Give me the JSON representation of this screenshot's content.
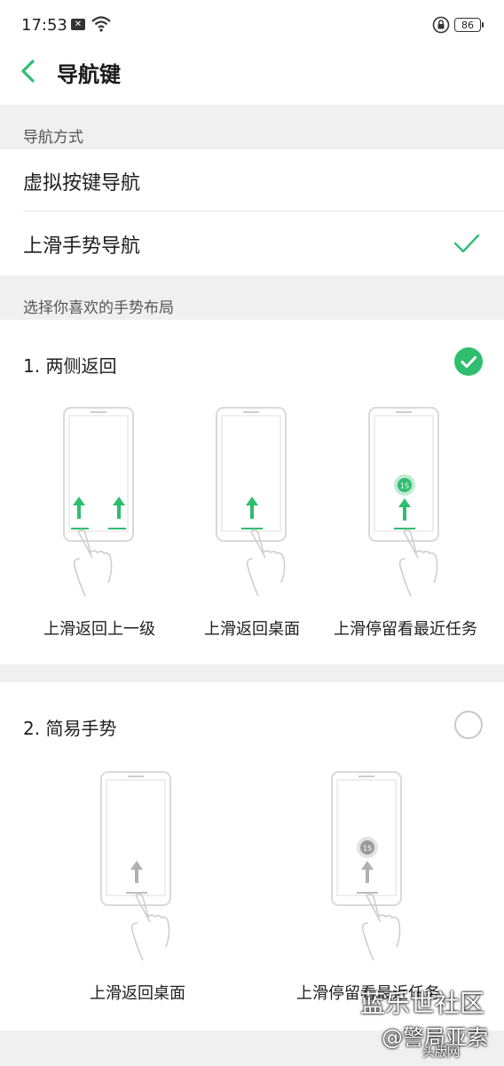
{
  "status_bar": {
    "time": "17:53",
    "battery": "86",
    "icons": [
      "message-icon",
      "wifi-icon",
      "lock-icon",
      "battery-icon"
    ]
  },
  "header": {
    "title": "导航键",
    "back_icon": "chevron-left-icon"
  },
  "sections": {
    "nav_mode_label": "导航方式",
    "layout_label": "选择你喜欢的手势布局"
  },
  "nav_modes": [
    {
      "label": "虚拟按键导航",
      "selected": false
    },
    {
      "label": "上滑手势导航",
      "selected": true
    }
  ],
  "layouts": [
    {
      "title": "1. 两侧返回",
      "selected": true,
      "captions": [
        "上滑返回上一级",
        "上滑返回桌面",
        "上滑停留看最近任务"
      ]
    },
    {
      "title": "2. 简易手势",
      "selected": false,
      "captions": [
        "上滑返回桌面",
        "上滑停留看最近任务"
      ]
    }
  ],
  "hold_badge": "1S",
  "watermark": {
    "line1": "蓝乐世社区",
    "line2": "@警局亚索",
    "line3": "头版网"
  },
  "colors": {
    "accent": "#2fbe6f",
    "background": "#ffffff",
    "band": "#f0f0f0",
    "inactive_arrow": "#b0b0b0"
  }
}
